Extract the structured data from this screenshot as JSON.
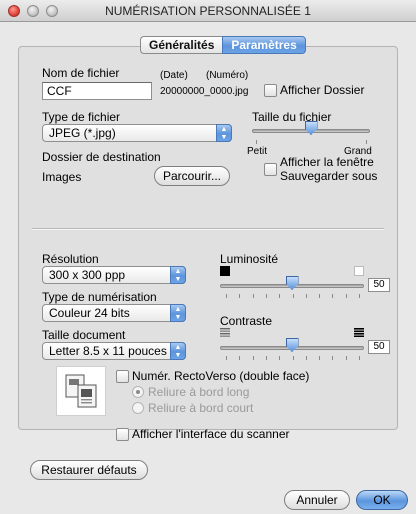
{
  "window": {
    "title": "NUMÉRISATION PERSONNALISÉE 1"
  },
  "tabs": [
    "Généralités",
    "Paramètres"
  ],
  "file": {
    "name_label": "Nom de fichier",
    "name_value": "CCF",
    "date_label": "(Date)",
    "number_label": "(Numéro)",
    "example": "20000000_0000.jpg",
    "show_folder_label": "Afficher Dossier",
    "type_label": "Type de fichier",
    "type_value": "JPEG (*.jpg)",
    "size_label": "Taille du fichier",
    "size_small": "Petit",
    "size_large": "Grand",
    "size_level": 0.5,
    "dest_label": "Dossier de destination",
    "dest_value": "Images",
    "browse_label": "Parcourir...",
    "save_as_label_1": "Afficher la fenêtre",
    "save_as_label_2": "Sauvegarder sous"
  },
  "scan": {
    "resolution_label": "Résolution",
    "resolution_value": "300 x 300 ppp",
    "scantype_label": "Type de numérisation",
    "scantype_value": "Couleur 24 bits",
    "docsize_label": "Taille document",
    "docsize_value": "Letter  8.5 x 11 pouces",
    "brightness_label": "Luminosité",
    "brightness_value": "50",
    "contrast_label": "Contraste",
    "contrast_value": "50",
    "duplex_label": "Numér. RectoVerso (double face)",
    "bind_long_label": "Reliure à bord long",
    "bind_short_label": "Reliure à bord court",
    "scanner_ui_label": "Afficher l'interface du scanner"
  },
  "buttons": {
    "restore": "Restaurer défauts",
    "cancel": "Annuler",
    "ok": "OK"
  },
  "colors": {
    "accent": "#5b95dd",
    "close": "#e0443a"
  }
}
